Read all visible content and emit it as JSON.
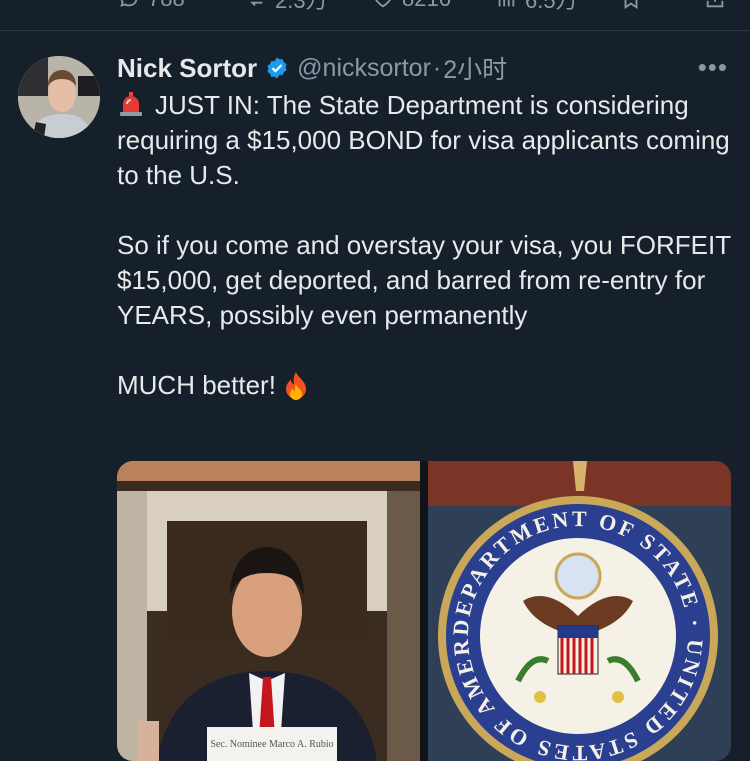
{
  "top_actions": {
    "replies": "788",
    "reposts": "2.3万",
    "likes": "8216",
    "views": "6.5万"
  },
  "tweet": {
    "author_name": "Nick Sortor",
    "handle": "@nicksortor",
    "separator": "·",
    "time": "2小时",
    "more_label": "•••",
    "line1": "JUST IN: The State Department is considering requiring a $15,000 BOND for visa applicants coming to the U.S.",
    "line2": "So if you come and overstay your visa, you FORFEIT $15,000, get deported, and barred from re-entry for YEARS, possibly even permanently",
    "line3": "MUCH better!"
  },
  "media": {
    "seal_text": "DEPARTMENT OF STATE · UNITED STATES OF AMERICA",
    "nameplate": "Sec. Nominee Marco A. Rubio"
  },
  "colors": {
    "background": "#15202b",
    "verified": "#1d9bf0",
    "muted": "#8b98a5"
  }
}
